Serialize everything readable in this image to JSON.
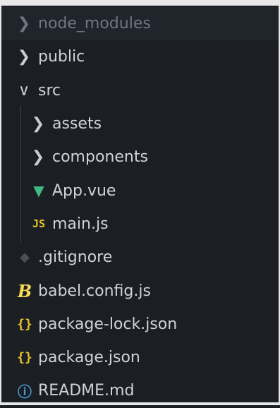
{
  "colors": {
    "background": "#1b1f24",
    "text": "#cfd3d8",
    "dim_text": "#6e7680",
    "vue": "#41b883",
    "js": "#e6c229",
    "info": "#4aa3df"
  },
  "explorer": {
    "items": [
      {
        "label": "node_modules",
        "type": "folder",
        "expanded": false,
        "icon": "chevron-right-icon",
        "glyph": "❯"
      },
      {
        "label": "public",
        "type": "folder",
        "expanded": false,
        "icon": "chevron-right-icon",
        "glyph": "❯"
      },
      {
        "label": "src",
        "type": "folder",
        "expanded": true,
        "icon": "chevron-down-icon",
        "glyph": "∨"
      },
      {
        "label": "assets",
        "type": "folder",
        "expanded": false,
        "icon": "chevron-right-icon",
        "glyph": "❯"
      },
      {
        "label": "components",
        "type": "folder",
        "expanded": false,
        "icon": "chevron-right-icon",
        "glyph": "❯"
      },
      {
        "label": "App.vue",
        "type": "file",
        "icon": "vue-icon",
        "glyph": "▼"
      },
      {
        "label": "main.js",
        "type": "file",
        "icon": "js-icon",
        "glyph": "JS"
      },
      {
        "label": ".gitignore",
        "type": "file",
        "icon": "git-icon",
        "glyph": "◆"
      },
      {
        "label": "babel.config.js",
        "type": "file",
        "icon": "babel-icon",
        "glyph": "B"
      },
      {
        "label": "package-lock.json",
        "type": "file",
        "icon": "json-icon",
        "glyph": "{}"
      },
      {
        "label": "package.json",
        "type": "file",
        "icon": "json-icon",
        "glyph": "{}"
      },
      {
        "label": "README.md",
        "type": "file",
        "icon": "info-icon",
        "glyph": "ⓘ"
      }
    ]
  }
}
